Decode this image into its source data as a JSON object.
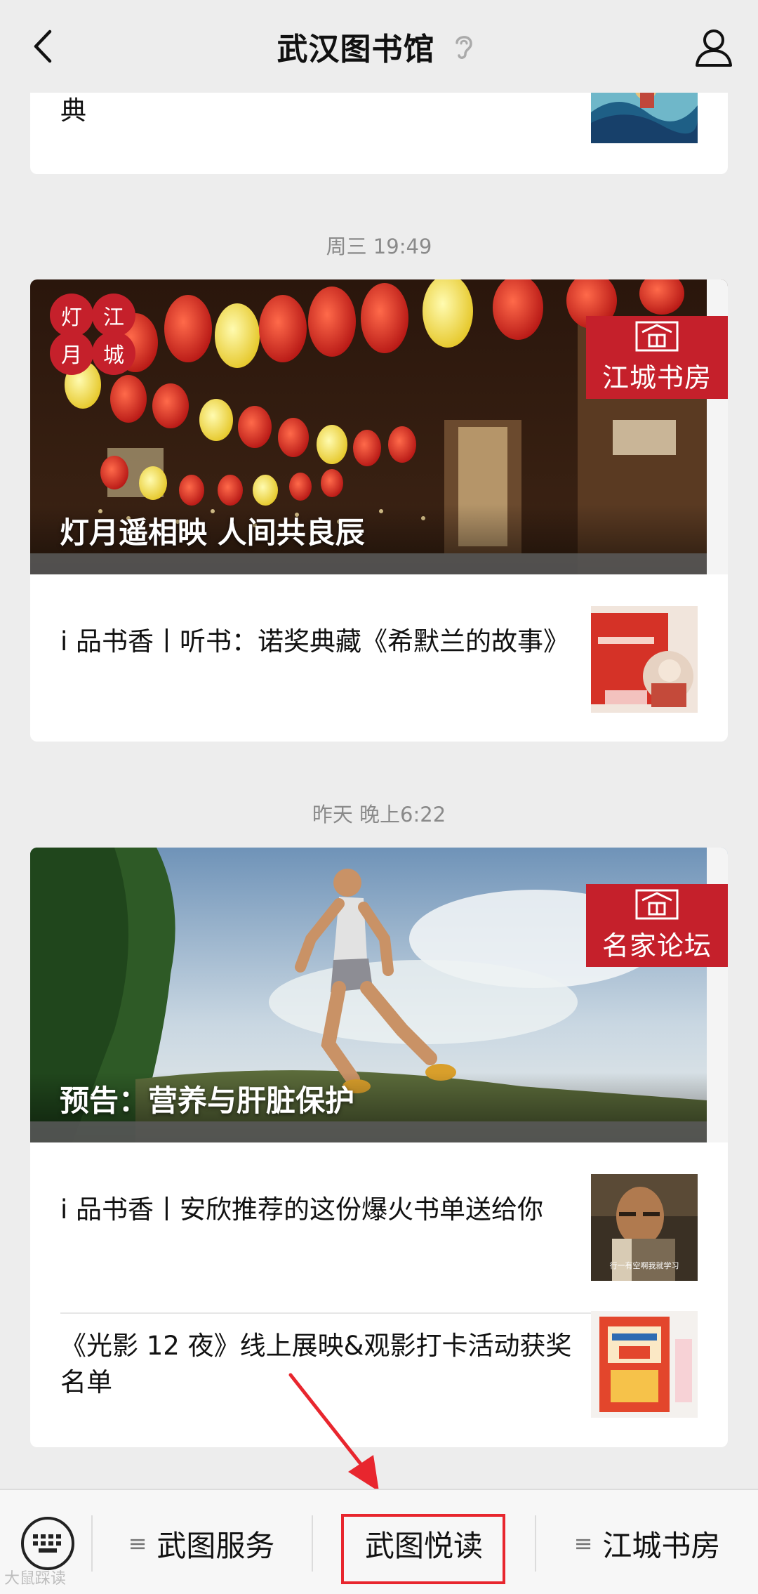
{
  "header": {
    "title": "武汉图书馆",
    "back_icon": "chevron-left-icon",
    "listen_icon": "ear-icon",
    "profile_icon": "person-icon"
  },
  "top_partial": {
    "text": "典"
  },
  "messages": [
    {
      "timestamp": "周三 19:49",
      "hero_caption": "灯月遥相映 人间共良辰",
      "hero_badge": "江城书房",
      "corner_badge": [
        "灯",
        "江",
        "月",
        "城"
      ],
      "items": [
        {
          "title": "i 品书香丨听书：诺奖典藏《希默兰的故事》"
        }
      ]
    },
    {
      "timestamp": "昨天 晚上6:22",
      "hero_caption": "预告：营养与肝脏保护",
      "hero_badge": "名家论坛",
      "items": [
        {
          "title": "i 品书香丨安欣推荐的这份爆火书单送给你",
          "thumb_caption": "行一有空啊我就学习"
        },
        {
          "title": "《光影 12 夜》线上展映&观影打卡活动获奖名单"
        }
      ]
    }
  ],
  "menu": {
    "keyboard_icon": "keyboard-icon",
    "items": [
      {
        "label": "武图服务",
        "icon": "hamburger-icon"
      },
      {
        "label": "武图悦读"
      },
      {
        "label": "江城书房",
        "icon": "hamburger-icon"
      }
    ]
  },
  "annotation": {
    "color": "#e8262e"
  },
  "watermark": "大鼠踩读"
}
